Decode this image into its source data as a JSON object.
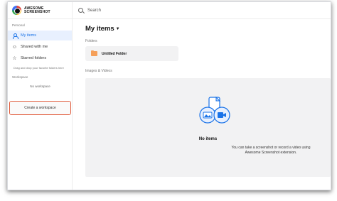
{
  "header": {
    "logo_text_line1": "AWESOME",
    "logo_text_line2": "SCREENSHOT",
    "search_placeholder": "Search"
  },
  "sidebar": {
    "personal_label": "Personal",
    "items": [
      {
        "label": "My items",
        "icon": "person-icon",
        "active": true
      },
      {
        "label": "Shared with me",
        "icon": "people-icon",
        "active": false
      },
      {
        "label": "Starred folders",
        "icon": "star-icon",
        "active": false
      }
    ],
    "starred_hint": "Drag and drop your favorite folders here",
    "workspace_label": "Workspace",
    "no_workspace": "No workspace",
    "create_workspace": "Create a workspace"
  },
  "main": {
    "title": "My items",
    "folders_label": "Folders",
    "folders": [
      {
        "name": "Untitled Folder"
      }
    ],
    "media_label": "Images & Videos",
    "empty_title": "No items",
    "empty_desc": "You can take a screenshot or record a video using Awesome Screenshot extension."
  },
  "colors": {
    "accent": "#1a73e8",
    "highlight_border": "#e05a3a",
    "folder": "#f5a05a",
    "panel": "#f2f2f3"
  }
}
